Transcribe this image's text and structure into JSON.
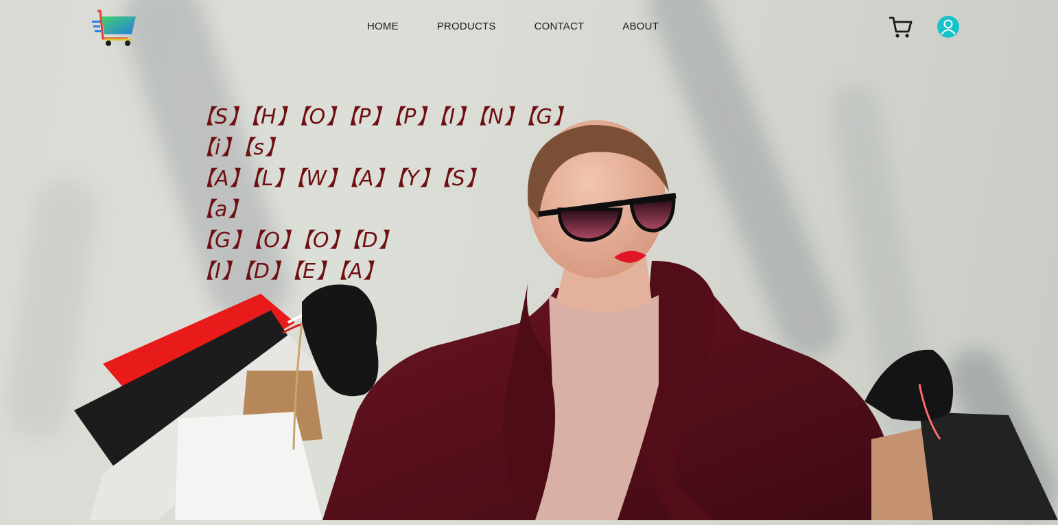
{
  "nav": {
    "items": [
      {
        "label": "HOME"
      },
      {
        "label": "PRODUCTS"
      },
      {
        "label": "CONTACT"
      },
      {
        "label": "ABOUT"
      }
    ]
  },
  "header": {
    "logo_icon": "shopping-cart-logo",
    "cart_icon": "cart-icon",
    "user_icon": "user-icon"
  },
  "hero": {
    "lines": [
      "【S】【H】【O】【P】【P】【I】【N】【G】",
      "【i】【s】",
      "【A】【L】【W】【A】【Y】【S】",
      "【a】",
      "【G】【O】【O】【D】",
      "【I】【D】【E】【A】"
    ]
  },
  "colors": {
    "hero_text": "#6e0f12",
    "coat": "#5a0f1a",
    "user_icon": "#17c3c9"
  }
}
